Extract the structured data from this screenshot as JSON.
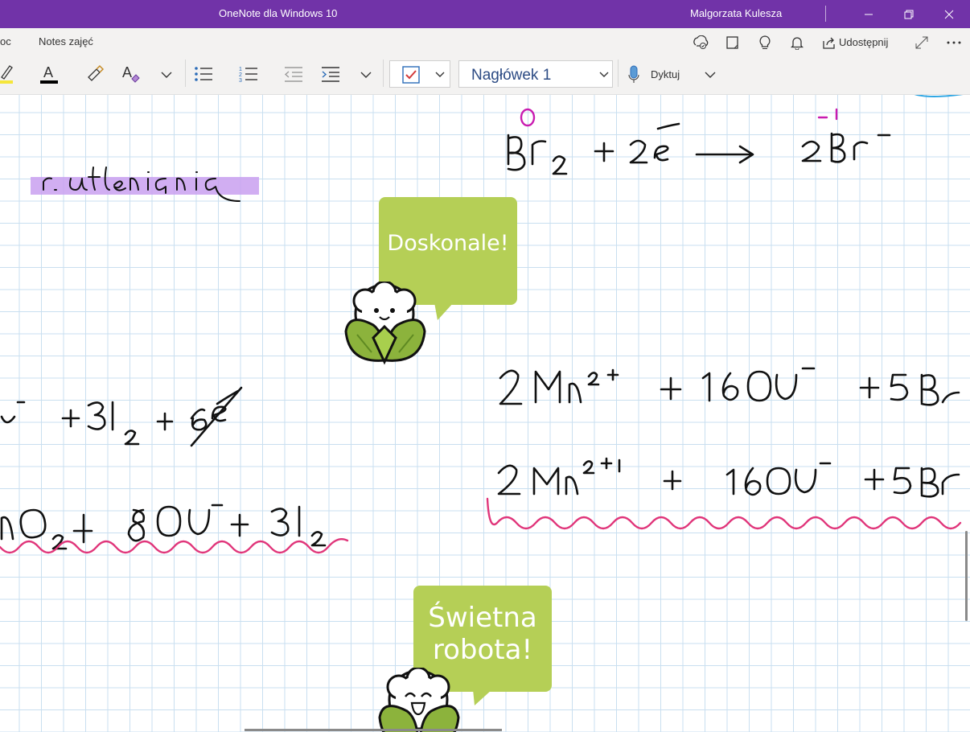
{
  "window": {
    "app_title": "OneNote dla Windows 10",
    "user_name": "Malgorzata Kulesza",
    "controls": [
      "minimize-icon",
      "restore-icon",
      "close-icon"
    ]
  },
  "ribbon": {
    "tabs": [
      "oc",
      "Notes zajęć"
    ],
    "share_label": "Udostępnij",
    "style_value": "Nagłówek 1",
    "dictate_label": "Dyktuj",
    "colors": {
      "title_bar": "#7133a8",
      "highlighter": "#f5e63a",
      "font_color_bar": "#000000"
    }
  },
  "stickers": [
    {
      "text": "Doskonale!",
      "color": "#b5cf56"
    },
    {
      "line1": "Świetna",
      "line2": "robota!",
      "color": "#b5cf56"
    }
  ],
  "handwriting": {
    "colors": {
      "ink": "#111111",
      "magenta": "#c91bb0",
      "blue": "#2fa6e3",
      "highlight": "#c9a0f0",
      "underline": "#e0357a"
    }
  }
}
